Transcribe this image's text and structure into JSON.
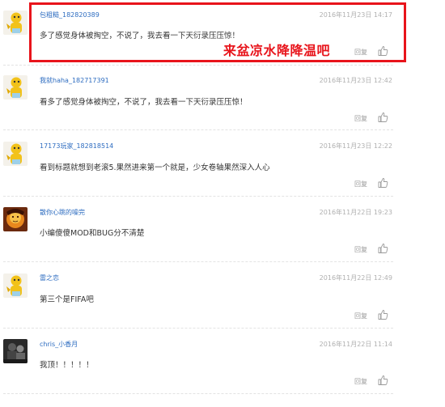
{
  "annotation": {
    "text": "来盆凉水降降温吧",
    "color": "#e8141b"
  },
  "actions": {
    "reply_label": "回复",
    "like_icon": "thumbs-up-icon"
  },
  "comments": [
    {
      "username": "包粗糙_182820389",
      "time": "2016年11月23日 14:17",
      "content": "多了感觉身体被掏空，不说了，我去看一下天衍录压压惊！",
      "avatar": "yellow-cartoon-avatar"
    },
    {
      "username": "我就haha_182717391",
      "time": "2016年11月23日 12:42",
      "content": "看多了感觉身体被掏空，不说了，我去看一下天衍录压压惊！",
      "avatar": "yellow-cartoon-avatar"
    },
    {
      "username": "17173玩家_182818514",
      "time": "2016年11月23日 12:22",
      "content": "看到标题就想到老滚5.果然进来第一个就是，少女卷轴果然深入人心",
      "avatar": "yellow-cartoon-avatar"
    },
    {
      "username": "散你心跳的噪完",
      "time": "2016年11月22日 19:23",
      "content": "小编傻傻MOD和BUG分不清楚",
      "avatar": "orange-face-avatar"
    },
    {
      "username": "雷之恋",
      "time": "2016年11月22日 12:49",
      "content": "第三个是FIFA吧",
      "avatar": "yellow-cartoon-avatar"
    },
    {
      "username": "chris_小香月",
      "time": "2016年11月22日 11:14",
      "content": "我顶！！！！！",
      "avatar": "dark-photo-avatar"
    }
  ]
}
